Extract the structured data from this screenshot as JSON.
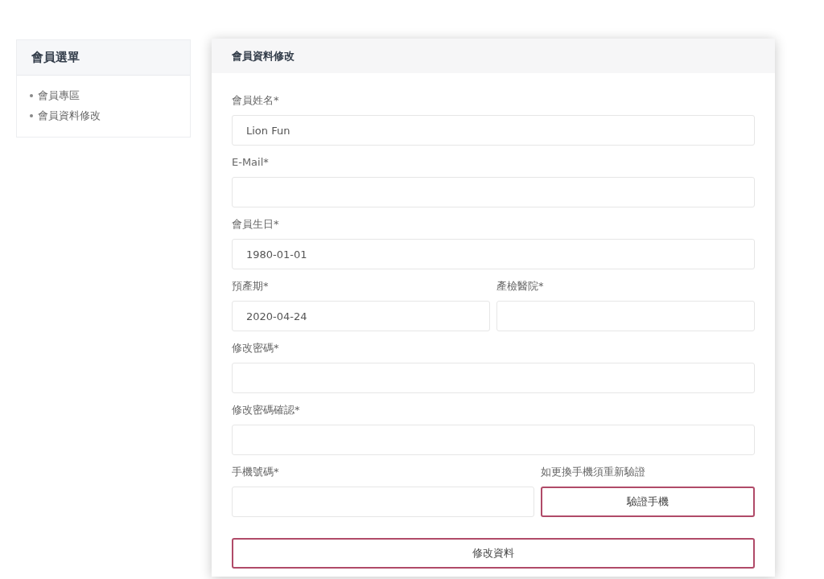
{
  "sidebar": {
    "title": "會員選單",
    "items": [
      {
        "label": "會員專區"
      },
      {
        "label": "會員資料修改"
      }
    ]
  },
  "form": {
    "title": "會員資料修改",
    "rows": [
      {
        "cells": [
          {
            "label": "會員姓名*",
            "kind": "input",
            "value": "Lion Fun"
          }
        ]
      },
      {
        "cells": [
          {
            "label": "E-Mail*",
            "kind": "input"
          }
        ]
      },
      {
        "cells": [
          {
            "label": "會員生日*",
            "kind": "input",
            "value": "1980-01-01"
          }
        ]
      },
      {
        "cells": [
          {
            "label": "預產期*",
            "kind": "input",
            "value": "2020-04-24"
          },
          {
            "label": "產檢醫院*",
            "kind": "input"
          }
        ]
      },
      {
        "cells": [
          {
            "label": "修改密碼*",
            "kind": "input"
          }
        ]
      },
      {
        "cells": [
          {
            "label": "修改密碼確認*",
            "kind": "input"
          }
        ]
      },
      {
        "cells": [
          {
            "label": "手機號碼*",
            "kind": "input"
          },
          {
            "label": "如更換手機須重新驗證",
            "kind": "button",
            "button": "驗證手機"
          }
        ]
      }
    ],
    "submit": "修改資料"
  }
}
